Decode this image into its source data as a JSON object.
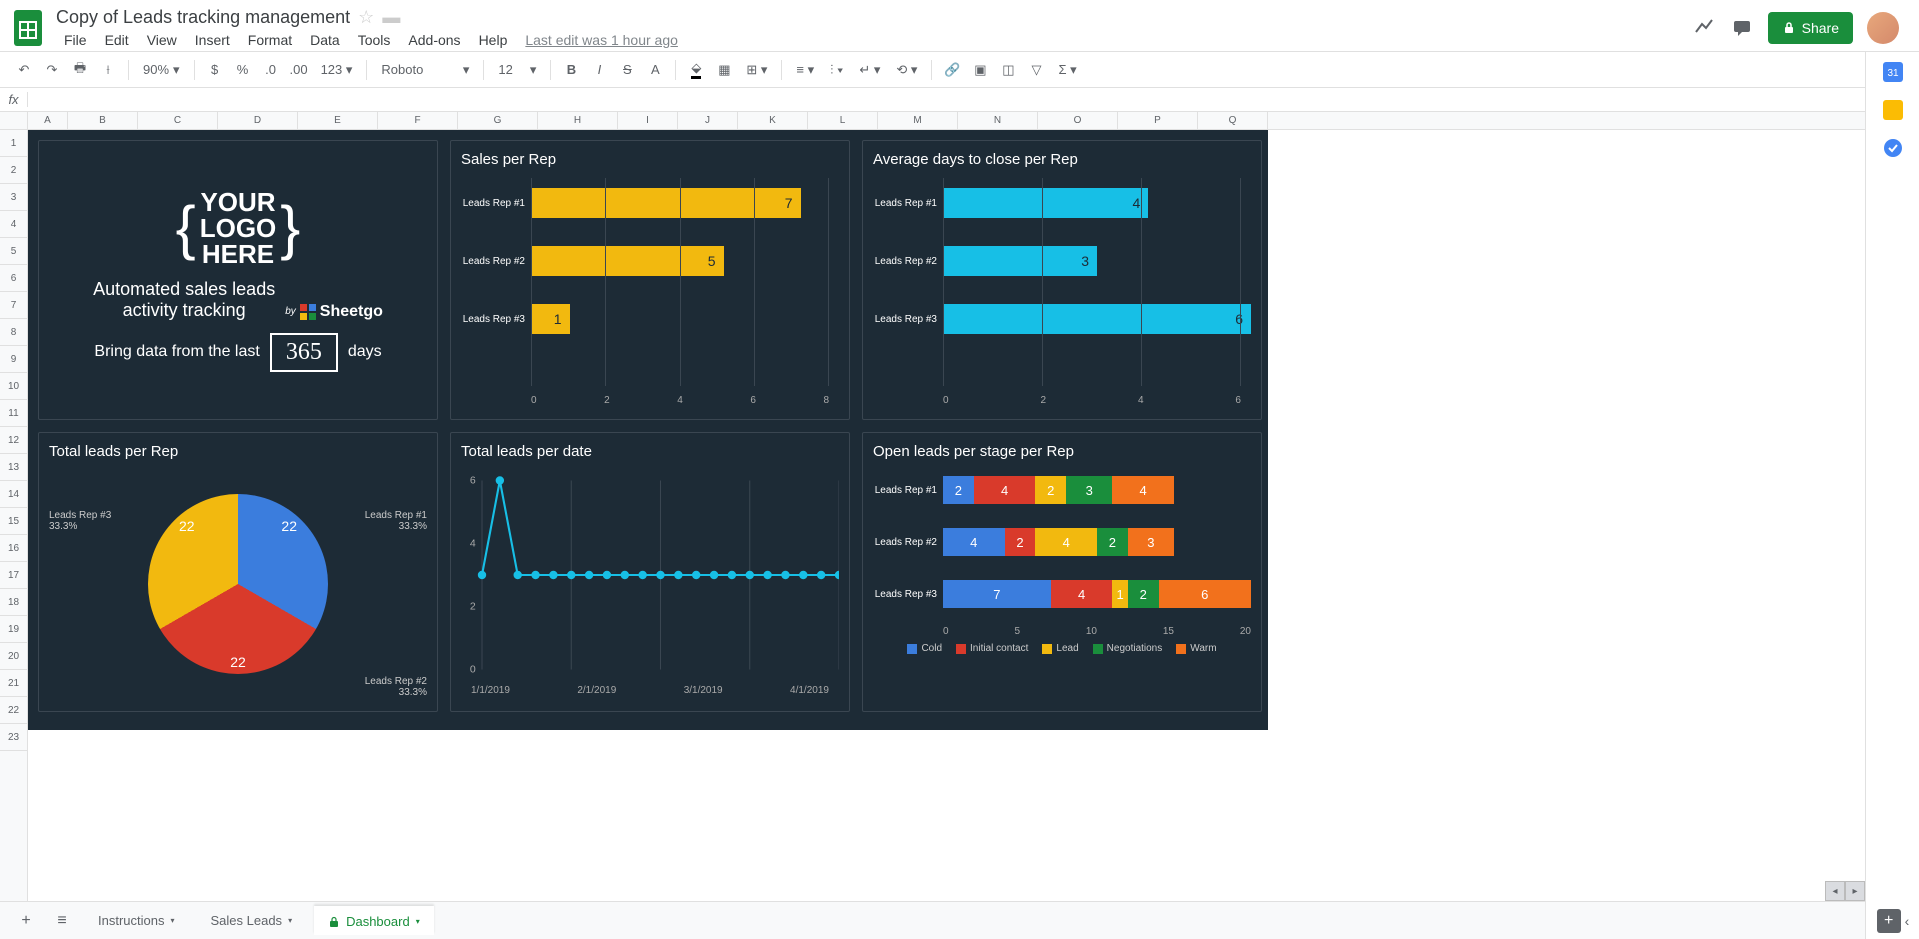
{
  "doc": {
    "title": "Copy of Leads tracking management",
    "last_edit": "Last edit was 1 hour ago"
  },
  "menu": [
    "File",
    "Edit",
    "View",
    "Insert",
    "Format",
    "Data",
    "Tools",
    "Add-ons",
    "Help"
  ],
  "share_label": "Share",
  "toolbar": {
    "zoom": "90%",
    "font": "Roboto",
    "font_size": "12"
  },
  "columns": [
    "A",
    "B",
    "C",
    "D",
    "E",
    "F",
    "G",
    "H",
    "I",
    "J",
    "K",
    "L",
    "M",
    "N",
    "O",
    "P",
    "Q"
  ],
  "rows": [
    "1",
    "2",
    "3",
    "4",
    "5",
    "6",
    "7",
    "8",
    "9",
    "10",
    "11",
    "12",
    "13",
    "14",
    "15",
    "16",
    "17",
    "18",
    "19",
    "20",
    "21",
    "22",
    "23"
  ],
  "dashboard": {
    "logo": {
      "l1": "YOUR",
      "l2": "LOGO",
      "l3": "HERE"
    },
    "subtitle_l1": "Automated sales leads",
    "subtitle_l2": "activity tracking",
    "sheetgo_by": "by",
    "sheetgo": "Sheetgo",
    "bring_l": "Bring data from the last",
    "bring_days": "365",
    "bring_r": "days",
    "sales_per_rep_title": "Sales per Rep",
    "avg_days_title": "Average days to close per Rep",
    "total_leads_rep_title": "Total leads per Rep",
    "total_leads_date_title": "Total leads per date",
    "open_leads_title": "Open leads per stage per Rep",
    "rep_labels": [
      "Leads Rep #1",
      "Leads Rep #2",
      "Leads Rep #3"
    ],
    "pie_pct": "33.3%",
    "stacked_legend": [
      "Cold",
      "Initial contact",
      "Lead",
      "Negotiations",
      "Warm"
    ]
  },
  "tabs": {
    "add": "+",
    "instructions": "Instructions",
    "sales_leads": "Sales Leads",
    "dashboard": "Dashboard"
  },
  "chart_data": [
    {
      "type": "bar",
      "title": "Sales per Rep",
      "categories": [
        "Leads Rep #1",
        "Leads Rep #2",
        "Leads Rep #3"
      ],
      "values": [
        7,
        5,
        1
      ],
      "xlim": [
        0,
        8
      ],
      "color": "#f2b90f",
      "orientation": "horizontal"
    },
    {
      "type": "bar",
      "title": "Average days to close per Rep",
      "categories": [
        "Leads Rep #1",
        "Leads Rep #2",
        "Leads Rep #3"
      ],
      "values": [
        4,
        3,
        6
      ],
      "xlim": [
        0,
        6
      ],
      "color": "#17bfe6",
      "orientation": "horizontal"
    },
    {
      "type": "pie",
      "title": "Total leads per Rep",
      "categories": [
        "Leads Rep #1",
        "Leads Rep #2",
        "Leads Rep #3"
      ],
      "values": [
        22,
        22,
        22
      ],
      "colors": [
        "#3b7ddd",
        "#d93a2b",
        "#f2b90f"
      ]
    },
    {
      "type": "line",
      "title": "Total leads per date",
      "x_labels": [
        "1/1/2019",
        "2/1/2019",
        "3/1/2019",
        "4/1/2019"
      ],
      "x": [
        0,
        1,
        2,
        3,
        4,
        5,
        6,
        7,
        8,
        9,
        10,
        11,
        12,
        13,
        14,
        15,
        16,
        17,
        18,
        19,
        20
      ],
      "y": [
        3,
        6,
        3,
        3,
        3,
        3,
        3,
        3,
        3,
        3,
        3,
        3,
        3,
        3,
        3,
        3,
        3,
        3,
        3,
        3,
        3
      ],
      "ylim": [
        0,
        6
      ],
      "color": "#17bfe6"
    },
    {
      "type": "bar",
      "title": "Open leads per stage per Rep",
      "stacked": true,
      "categories": [
        "Leads Rep #1",
        "Leads Rep #2",
        "Leads Rep #3"
      ],
      "series": [
        {
          "name": "Cold",
          "color": "#3b7ddd",
          "values": [
            2,
            4,
            7
          ]
        },
        {
          "name": "Initial contact",
          "color": "#d93a2b",
          "values": [
            4,
            2,
            4
          ]
        },
        {
          "name": "Lead",
          "color": "#f2b90f",
          "values": [
            2,
            4,
            1
          ]
        },
        {
          "name": "Negotiations",
          "color": "#1a8e3c",
          "values": [
            3,
            2,
            2
          ]
        },
        {
          "name": "Warm",
          "color": "#f2711c",
          "values": [
            4,
            3,
            6
          ]
        }
      ],
      "xlim": [
        0,
        20
      ],
      "orientation": "horizontal"
    }
  ]
}
